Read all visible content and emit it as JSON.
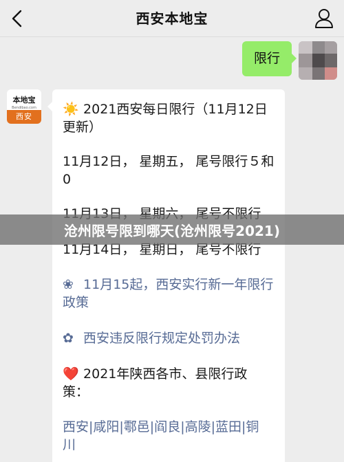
{
  "header": {
    "title": "西安本地宝",
    "back_icon": "chevron-left-icon",
    "profile_icon": "person-icon"
  },
  "my_message": {
    "text": "限行"
  },
  "bot_avatar": {
    "logo_text": "本地宝",
    "logo_sub": "Bendibao.com",
    "city": "西安"
  },
  "message": {
    "heading_sym": "☀️",
    "heading_line1": " 2021西安每日限行（11月12日",
    "heading_line2": "更新）",
    "day1_line1": "11月12日，  星期五，  尾号限行５和",
    "day1_line2": "0",
    "day2": "11月13日，  星期六，  尾号不限行",
    "day3": "11月14日，  星期日，  尾号不限行",
    "link1_sym": "❀",
    "link1_line1": " 11月15起，西安实行新一年限行",
    "link1_line2": "政策",
    "link2_sym": "✿",
    "link2_text": " 西安违反限行规定处罚办法",
    "policy_sym": "❤️",
    "policy_line1": " 2021年陕西各市、县限行政",
    "policy_line2": "策：",
    "cities_line1": "西安|咸阳|鄠邑|阎良|高陵|蓝田|铜",
    "cities_line2": "川"
  },
  "overlay": {
    "text": "沧州限号限到哪天(沧州限号2021)"
  },
  "colors": {
    "bubble_green": "#95ec69",
    "link": "#576b95",
    "logo_orange": "#e2701e"
  }
}
